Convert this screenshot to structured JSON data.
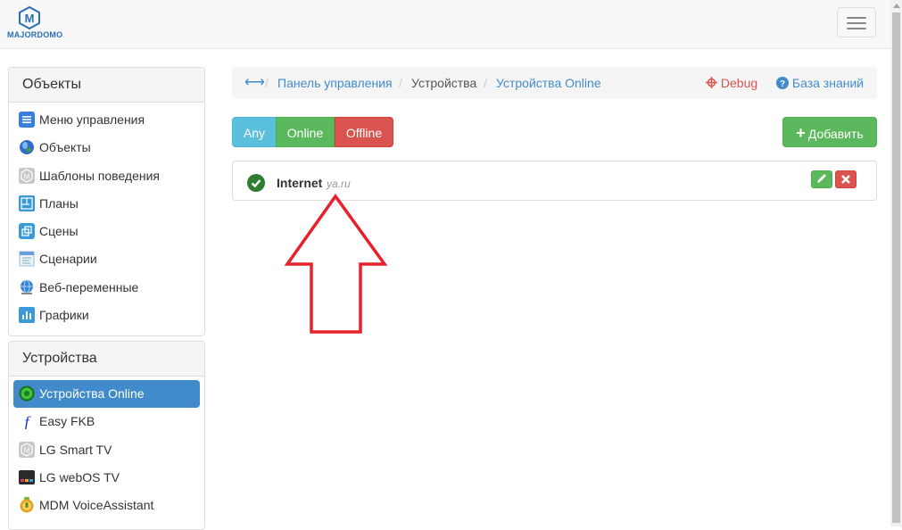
{
  "app": {
    "logo_text": "MAJORDOMO"
  },
  "sidebar": {
    "objects_panel": {
      "title": "Объекты",
      "items": [
        {
          "label": "Меню управления",
          "icon": "menu-list-icon"
        },
        {
          "label": "Объекты",
          "icon": "globe-icon"
        },
        {
          "label": "Шаблоны поведения",
          "icon": "majordomo-m-icon"
        },
        {
          "label": "Планы",
          "icon": "plan-icon"
        },
        {
          "label": "Сцены",
          "icon": "scenes-icon"
        },
        {
          "label": "Сценарии",
          "icon": "scripts-icon"
        },
        {
          "label": "Веб-переменные",
          "icon": "web-globe-icon"
        },
        {
          "label": "Графики",
          "icon": "chart-icon"
        }
      ]
    },
    "devices_panel": {
      "title": "Устройства",
      "items": [
        {
          "label": "Устройства Online",
          "icon": "green-dot-icon",
          "active": true
        },
        {
          "label": "Easy FKB",
          "icon": "fkb-f-icon"
        },
        {
          "label": "LG Smart TV",
          "icon": "majordomo-m-icon"
        },
        {
          "label": "LG webOS TV",
          "icon": "webos-icon"
        },
        {
          "label": "MDM VoiceAssistant",
          "icon": "voice-assistant-icon"
        }
      ]
    }
  },
  "breadcrumb": {
    "home_icon": "expand-arrows-icon",
    "items": [
      "Панель управления",
      "Устройства",
      "Устройства Online"
    ],
    "separator": "/",
    "debug_label": "Debug",
    "knowledge_label": "База знаний"
  },
  "filters": {
    "any": "Any",
    "online": "Online",
    "offline": "Offline"
  },
  "add_button": {
    "label": "Добавить"
  },
  "devices": [
    {
      "title": "Internet",
      "host": "ya.ru",
      "status": "online"
    }
  ],
  "colors": {
    "primary": "#428bca",
    "success": "#5cb85c",
    "danger": "#d9534f",
    "info": "#5bc0de",
    "annotation": "#e8202a"
  }
}
